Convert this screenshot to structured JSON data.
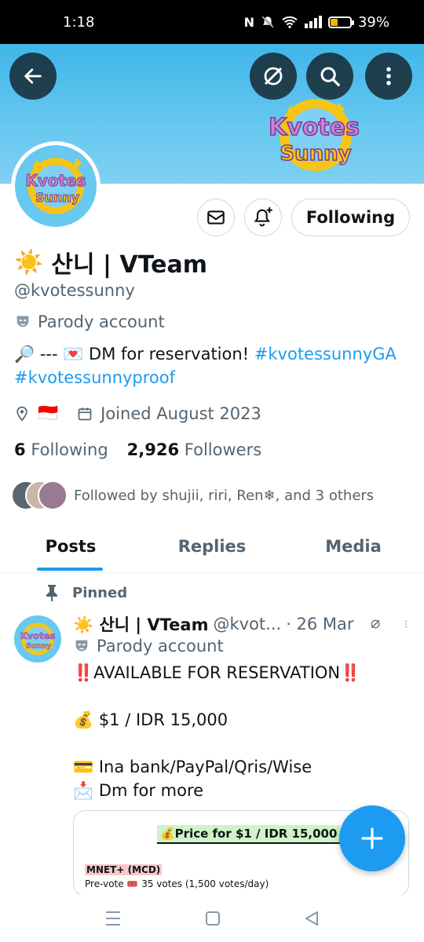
{
  "status_bar": {
    "time": "1:18",
    "battery": "39%",
    "battery_fraction": 0.39
  },
  "profile": {
    "name": "산니 | VTeam",
    "name_emoji": "☀️",
    "handle": "@kvotessunny",
    "label": "Parody account",
    "bio_parts": [
      "🔎 --- 💌 DM for reservation! ",
      "#kvotessunnyGA",
      " ",
      "#kvotessunnyproof"
    ],
    "location_flag": "🇮🇩",
    "joined": "Joined August 2023",
    "following_count": "6",
    "following_label": "Following",
    "followers_count": "2,926",
    "followers_label": "Followers",
    "followed_by": "Followed by shujii, riri, Ren❄, and 3 others",
    "follow_button": "Following",
    "banner_logo_text_1": "Kvotes",
    "banner_logo_text_2": "Sunny"
  },
  "tabs": [
    {
      "label": "Posts",
      "active": true
    },
    {
      "label": "Replies",
      "active": false
    },
    {
      "label": "Media",
      "active": false
    }
  ],
  "pinned_tweet": {
    "pinned_label": "Pinned",
    "name": "☀️ 산니 | VTeam",
    "handle": "@kvot...",
    "date": "· 26 Mar",
    "label": "Parody account",
    "lines": [
      "‼️AVAILABLE FOR RESERVATION‼️",
      "",
      "💰 $1 / IDR 15,000",
      "",
      "💳 Ina bank/PayPal/Qris/Wise",
      "📩 Dm for more"
    ],
    "card": {
      "price_title": "💰Price for $1 / IDR 15,000",
      "section": "MNET+ (MCD)",
      "pre_vote": "Pre-vote 🎟️ 35 votes (1,500 votes/day)"
    }
  },
  "colors": {
    "accent": "#1d9bf0",
    "banner": "#67c8f0",
    "text_secondary": "#536471"
  },
  "icons": [
    "back-arrow-icon",
    "grok-icon",
    "search-icon",
    "more-vertical-icon",
    "mail-icon",
    "bell-plus-icon",
    "mask-icon",
    "location-icon",
    "calendar-icon",
    "pin-icon",
    "plus-icon"
  ]
}
